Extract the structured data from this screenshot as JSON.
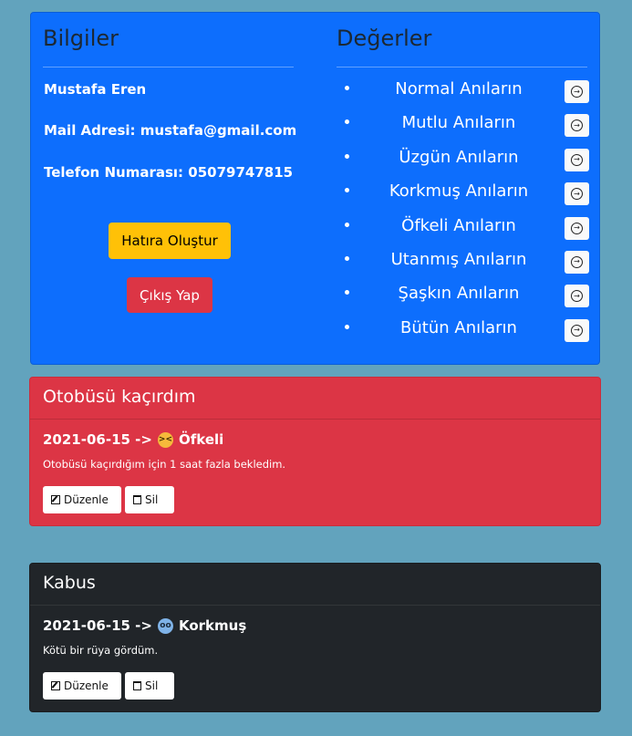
{
  "profile": {
    "info_title": "Bilgiler",
    "name": "Mustafa Eren",
    "email_line": "Mail Adresi: mustafa@gmail.com",
    "phone_line": "Telefon Numarası: 05079747815",
    "create_button": "Hatıra Oluştur",
    "logout_button": "Çıkış Yap"
  },
  "values": {
    "title": "Değerler",
    "items": [
      {
        "label": "Normal Anıların"
      },
      {
        "label": "Mutlu Anıların"
      },
      {
        "label": "Üzgün Anıların"
      },
      {
        "label": "Korkmuş Anıların"
      },
      {
        "label": "Öfkeli Anıların"
      },
      {
        "label": "Utanmış Anıların"
      },
      {
        "label": "Şaşkın Anıların"
      },
      {
        "label": "Bütün Anıların"
      }
    ]
  },
  "memories": [
    {
      "title": "Otobüsü kaçırdım",
      "date": "2021-06-15 ->",
      "mood": "Öfkeli",
      "mood_icon": "angry-face-icon",
      "description": "Otobüsü kaçırdığım için 1 saat fazla bekledim.",
      "edit_label": "Düzenle",
      "delete_label": "Sil",
      "color": "#dc3545"
    },
    {
      "title": "Kabus",
      "date": "2021-06-15 ->",
      "mood": "Korkmuş",
      "mood_icon": "fearful-face-icon",
      "description": "Kötü bir rüya gördüm.",
      "edit_label": "Düzenle",
      "delete_label": "Sil",
      "color": "#212529"
    }
  ],
  "colors": {
    "page_bg": "#62a3bd",
    "primary": "#0d6efd",
    "warning": "#ffc107",
    "danger": "#dc3545",
    "dark": "#212529"
  }
}
